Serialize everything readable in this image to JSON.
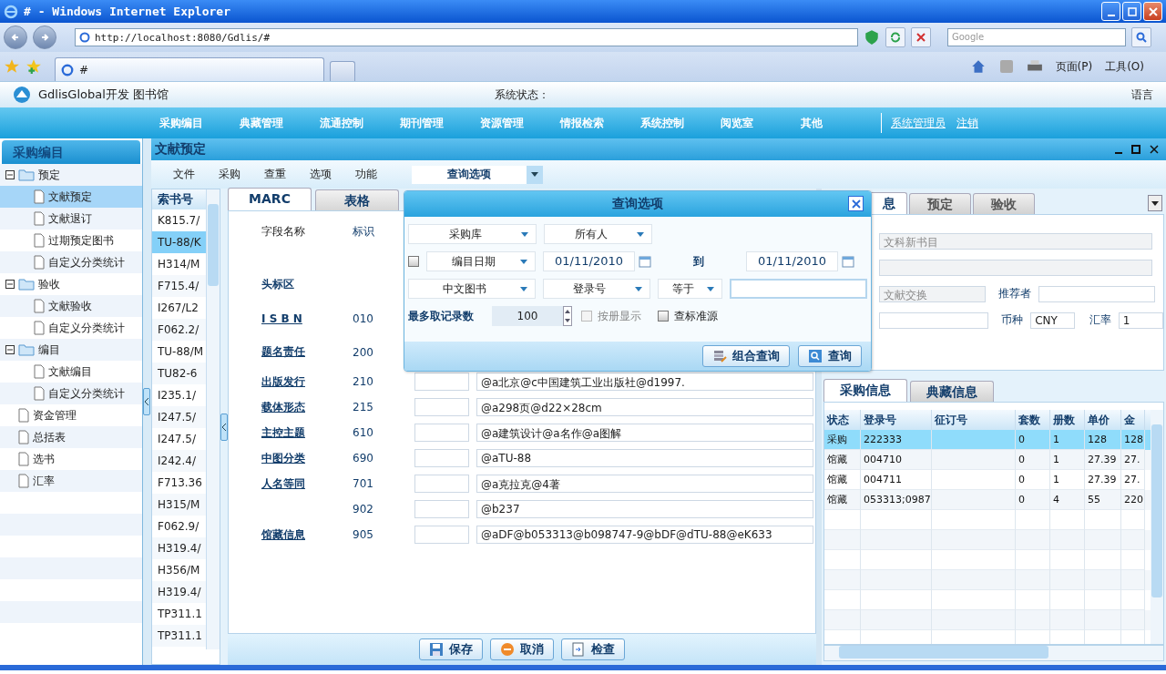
{
  "browser": {
    "title": "# - Windows Internet Explorer",
    "address": "http://localhost:8080/Gdlis/#",
    "search_placeholder": "Google",
    "tab": "#",
    "commands": [
      "页面(P)",
      "工具(O)"
    ]
  },
  "app": {
    "brand": "GdlisGlobal开发 图书馆",
    "status_label": "系统状态：",
    "language": "语言"
  },
  "nav": {
    "items": [
      "采购编目",
      "典藏管理",
      "流通控制",
      "期刊管理",
      "资源管理",
      "情报检索",
      "系统控制",
      "阅览室",
      "其他"
    ],
    "user": "系统管理员",
    "logout": "注销"
  },
  "sidebar": {
    "title": "采购编目",
    "tree": [
      {
        "label": "预定",
        "expanded": true,
        "children": [
          {
            "label": "文献预定",
            "selected": true
          },
          {
            "label": "文献退订",
            "selected": false
          },
          {
            "label": "过期预定图书",
            "selected": false
          },
          {
            "label": "自定义分类统计",
            "selected": false
          }
        ]
      },
      {
        "label": "验收",
        "expanded": true,
        "children": [
          {
            "label": "文献验收",
            "selected": false
          },
          {
            "label": "自定义分类统计",
            "selected": false
          }
        ]
      },
      {
        "label": "编目",
        "expanded": true,
        "children": [
          {
            "label": "文献编目",
            "selected": false
          },
          {
            "label": "自定义分类统计",
            "selected": false
          }
        ]
      },
      {
        "label": "资金管理",
        "selected": false
      },
      {
        "label": "总括表",
        "selected": false
      },
      {
        "label": "选书",
        "selected": false
      },
      {
        "label": "汇率",
        "selected": false
      }
    ]
  },
  "panel": {
    "title": "文献预定",
    "menu": [
      "文件",
      "采购",
      "查重",
      "选项",
      "功能"
    ],
    "query_dropdown": "查询选项"
  },
  "index_list": {
    "header": "索书号",
    "rows": [
      {
        "text": "K815.7/",
        "selected": false
      },
      {
        "text": "TU-88/K",
        "selected": true
      },
      {
        "text": "H314/M",
        "selected": false
      },
      {
        "text": "F715.4/",
        "selected": false
      },
      {
        "text": "I267/L2",
        "selected": false
      },
      {
        "text": "F062.2/",
        "selected": false
      },
      {
        "text": "TU-88/M",
        "selected": false
      },
      {
        "text": "TU82-6",
        "selected": false
      },
      {
        "text": "I235.1/",
        "selected": false
      },
      {
        "text": "I247.5/",
        "selected": false
      },
      {
        "text": "I247.5/",
        "selected": false
      },
      {
        "text": "I242.4/",
        "selected": false
      },
      {
        "text": "F713.36",
        "selected": false
      },
      {
        "text": "H315/M",
        "selected": false
      },
      {
        "text": "F062.9/",
        "selected": false
      },
      {
        "text": "H319.4/",
        "selected": false
      },
      {
        "text": "H356/M",
        "selected": false
      },
      {
        "text": "H319.4/",
        "selected": false
      },
      {
        "text": "TP311.1",
        "selected": false
      },
      {
        "text": "TP311.1",
        "selected": false
      }
    ]
  },
  "marc": {
    "tabs": [
      {
        "label": "MARC",
        "selected": true
      },
      {
        "label": "表格",
        "selected": false
      }
    ],
    "col_name": "字段名称",
    "col_code": "标识",
    "fields": [
      {
        "name": "头标区"
      },
      {
        "name": "I S B N",
        "code": "010"
      },
      {
        "name": "题名责任",
        "code": "200"
      },
      {
        "name": "出版发行",
        "code": "210",
        "value": "@a北京@c中国建筑工业出版社@d1997."
      },
      {
        "name": "载体形态",
        "code": "215",
        "value": "@a298页@d22×28cm"
      },
      {
        "name": "主控主题",
        "code": "610",
        "value": "@a建筑设计@a名作@a图解"
      },
      {
        "name": "中图分类",
        "code": "690",
        "value": "@aTU-88"
      },
      {
        "name": "人名等同",
        "code": "701",
        "value": "@a克拉克@4著"
      },
      {
        "code": "902",
        "value": "@b237"
      },
      {
        "name": "馆藏信息",
        "code": "905",
        "value": "@aDF@b053313@b098747-9@bDF@dTU-88@eK633"
      }
    ],
    "buttons": [
      {
        "label": "保存",
        "kind": "save"
      },
      {
        "label": "取消",
        "kind": "cancel"
      },
      {
        "label": "检查",
        "kind": "check"
      }
    ]
  },
  "dialog": {
    "title": "查询选项",
    "source": "采购库",
    "owner": "所有人",
    "date_enabled": false,
    "date_field": "编目日期",
    "date_from": "01/11/2010",
    "to_label": "到",
    "date_to": "01/11/2010",
    "category": "中文图书",
    "search_field": "登录号",
    "operator": "等于",
    "max_label": "最多取记录数",
    "max_value": "100",
    "options": [
      {
        "label": "按册显示",
        "checked": false,
        "disabled": true
      },
      {
        "label": "查标准源",
        "checked": false,
        "disabled": false
      }
    ],
    "buttons": [
      {
        "label": "组合查询",
        "kind": "combo"
      },
      {
        "label": "查询",
        "kind": "search"
      }
    ]
  },
  "detail": {
    "tabs": [
      {
        "label": "息",
        "selected": true
      },
      {
        "label": "预定",
        "selected": false
      },
      {
        "label": "验收",
        "selected": false
      }
    ],
    "catalog": "文科新书目",
    "source": "文献交换",
    "recommender_label": "推荐者",
    "currency_label": "币种",
    "currency": "CNY",
    "rate_label": "汇率",
    "rate": "1"
  },
  "orders": {
    "tabs": [
      {
        "label": "采购信息",
        "selected": true
      },
      {
        "label": "典藏信息",
        "selected": false
      }
    ],
    "columns": [
      "状态",
      "登录号",
      "征订号",
      "套数",
      "册数",
      "单价",
      "金"
    ],
    "rows": [
      {
        "cells": [
          "采购",
          "222333",
          "",
          "0",
          "1",
          "128",
          "128"
        ],
        "selected": true
      },
      {
        "cells": [
          "馆藏",
          "004710",
          "",
          "0",
          "1",
          "27.39",
          "27."
        ],
        "selected": false
      },
      {
        "cells": [
          "馆藏",
          "004711",
          "",
          "0",
          "1",
          "27.39",
          "27."
        ],
        "selected": false
      },
      {
        "cells": [
          "馆藏",
          "053313;0987",
          "",
          "0",
          "4",
          "55",
          "220"
        ],
        "selected": false
      }
    ]
  }
}
